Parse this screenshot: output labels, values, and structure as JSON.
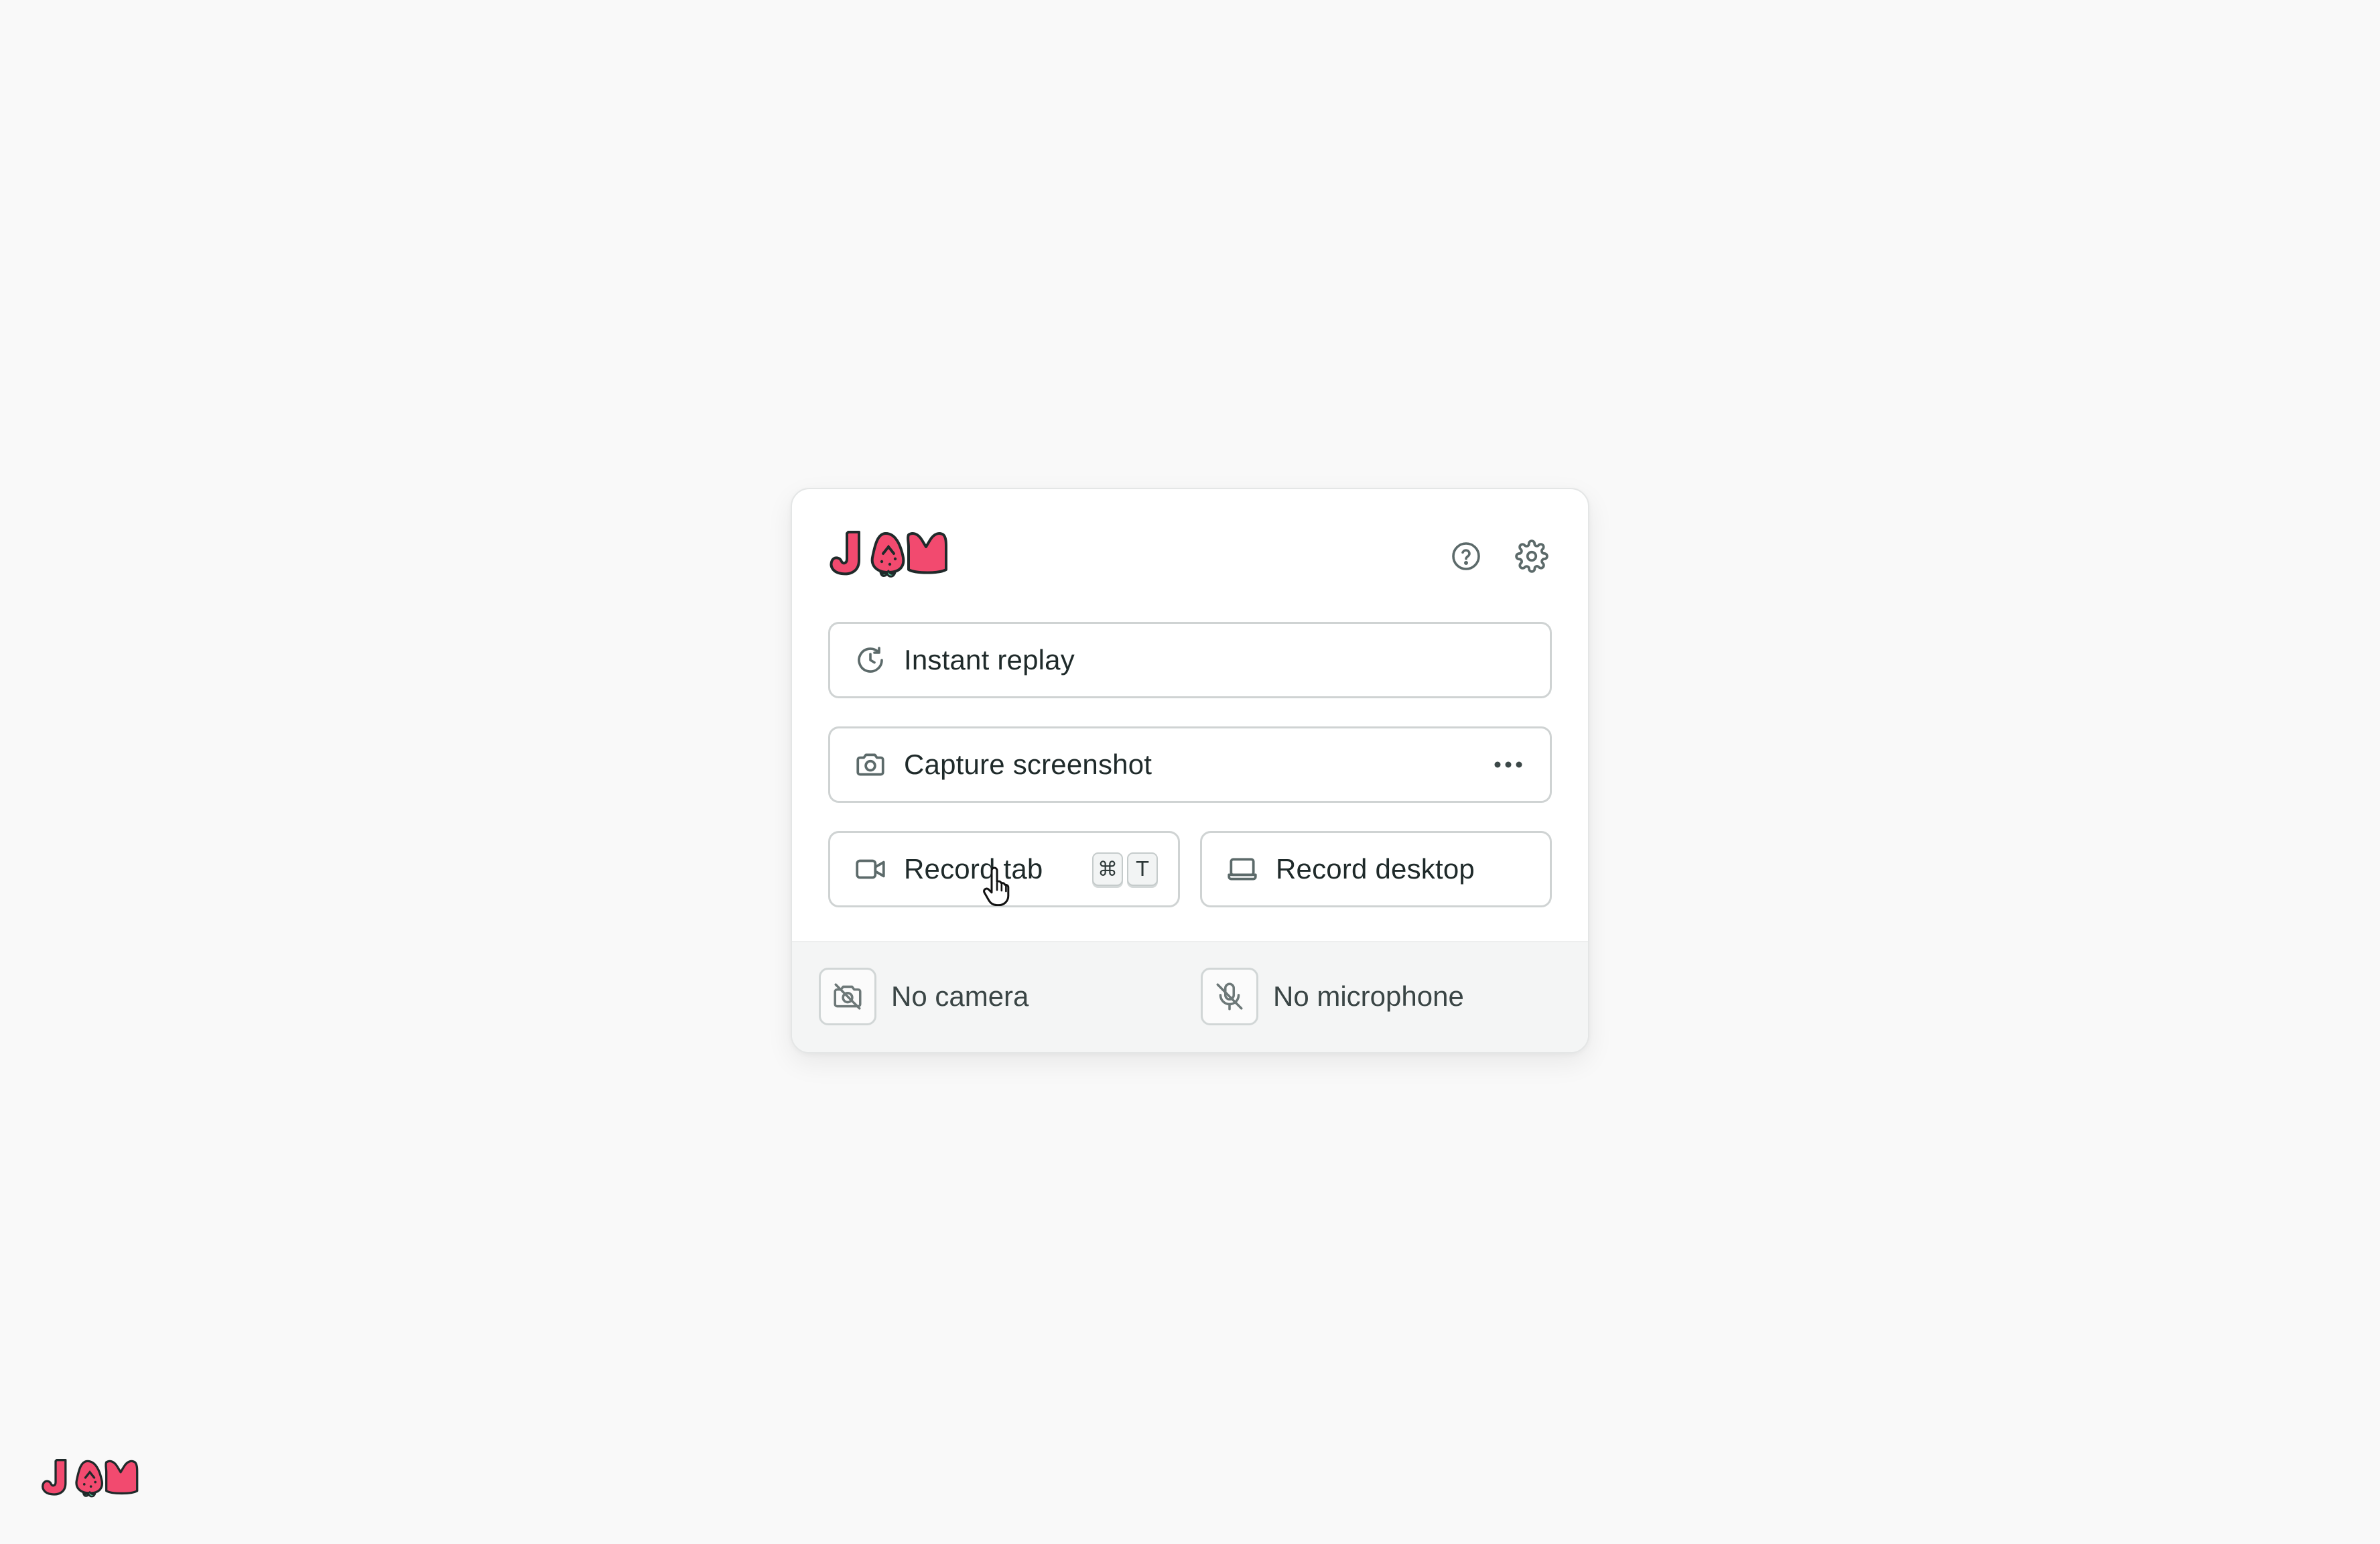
{
  "brand": {
    "logo_icon": "jam-strawberry-logo-icon",
    "color": "#f24a6f"
  },
  "header": {
    "help_icon": "help-circle-icon",
    "settings_icon": "gear-icon"
  },
  "actions": {
    "instant_replay": {
      "label": "Instant replay",
      "icon": "history-clock-icon"
    },
    "capture_screenshot": {
      "label": "Capture screenshot",
      "icon": "camera-icon",
      "more_icon": "ellipsis-icon"
    },
    "record_tab": {
      "label": "Record tab",
      "icon": "video-camera-icon",
      "shortcut": [
        "⌘",
        "T"
      ]
    },
    "record_desktop": {
      "label": "Record desktop",
      "icon": "laptop-icon"
    }
  },
  "footer": {
    "camera": {
      "label": "No camera",
      "icon": "camera-off-icon"
    },
    "microphone": {
      "label": "No microphone",
      "icon": "microphone-off-icon"
    }
  },
  "colors": {
    "background": "#f9f9f9",
    "card": "#ffffff",
    "footer": "#f4f5f5",
    "icon": "#5c6a6a",
    "border": "#cfd3d3"
  }
}
